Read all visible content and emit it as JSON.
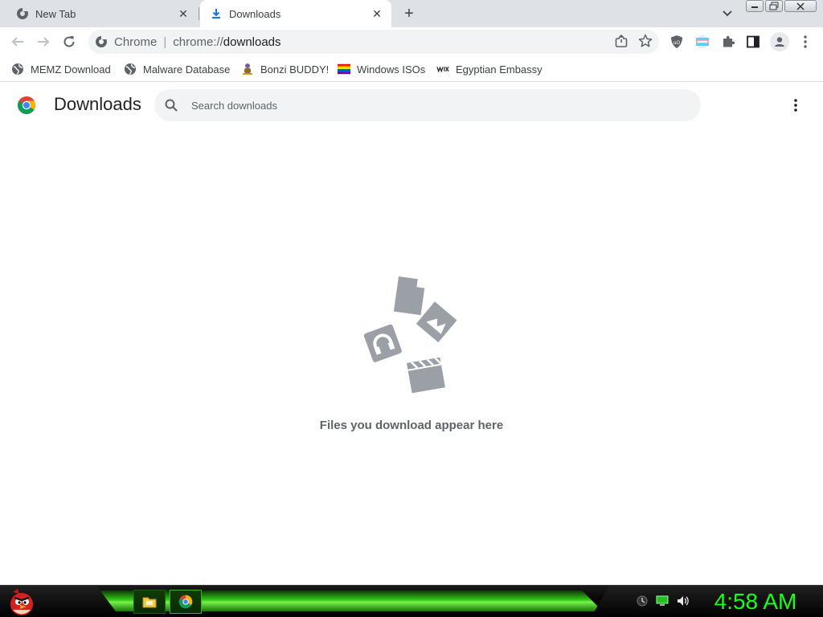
{
  "window": {
    "tabs": [
      {
        "title": "New Tab",
        "icon": "chrome-globe-icon",
        "active": false
      },
      {
        "title": "Downloads",
        "icon": "download-icon",
        "active": true
      }
    ],
    "new_tab_symbol": "+",
    "tab_close_symbol": "✕"
  },
  "toolbar": {
    "site_chip": "Chrome",
    "url_scheme": "chrome://",
    "url_path": "downloads"
  },
  "bookmarks": [
    {
      "label": "MEMZ Download",
      "icon": "globe-icon"
    },
    {
      "label": "Malware Database",
      "icon": "globe-icon"
    },
    {
      "label": "Bonzi BUDDY!",
      "icon": "bonzi-icon"
    },
    {
      "label": "Windows ISOs",
      "icon": "rainbow-flag-icon"
    },
    {
      "label": "Egyptian Embassy",
      "icon": "wix-icon"
    }
  ],
  "downloads": {
    "title": "Downloads",
    "search_placeholder": "Search downloads",
    "empty_message": "Files you download appear here"
  },
  "taskbar": {
    "clock": "4:58 AM",
    "accent_color": "#19ff19"
  }
}
